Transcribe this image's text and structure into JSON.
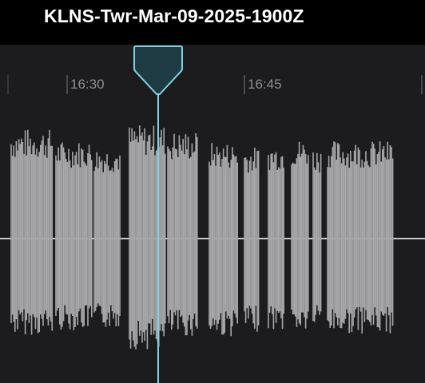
{
  "recording": {
    "title": "KLNS-Twr-Mar-09-2025-1900Z"
  },
  "timeline": {
    "ticks": [
      "16:30",
      "16:45"
    ]
  },
  "playhead": {
    "handle_color": "#1e3b44",
    "accent_color": "#7fd3df"
  },
  "waveform": {
    "color": "#a7a7aa",
    "baseline_color": "#c8c8cc",
    "background": "#1c1c1e"
  }
}
